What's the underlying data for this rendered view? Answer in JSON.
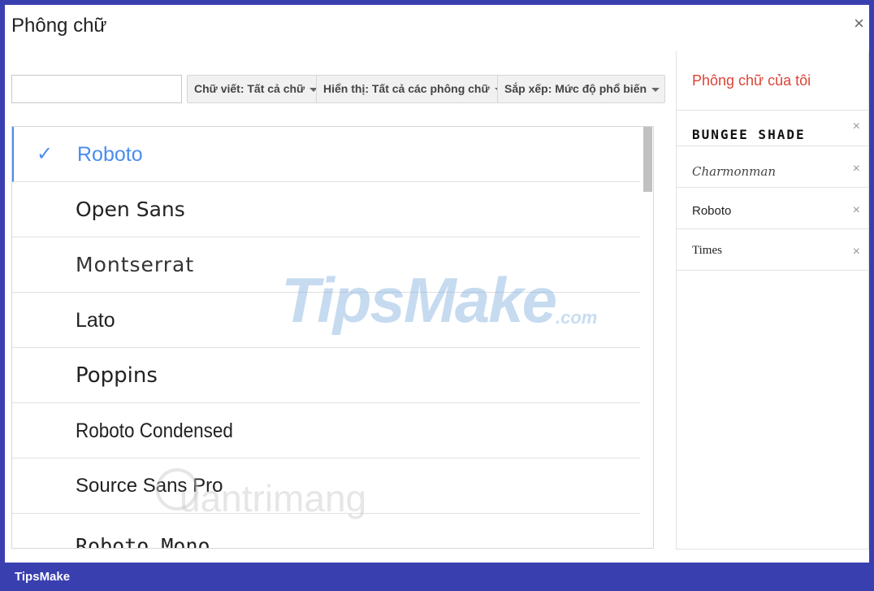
{
  "dialog": {
    "title": "Phông chữ",
    "close_glyph": "×"
  },
  "toolbar": {
    "search_value": "",
    "script_filter": "Chữ viết: Tất cả chữ",
    "show_filter": "Hiển thị: Tất cả các phông chữ",
    "sort_filter": "Sắp xếp: Mức độ phổ biến"
  },
  "fonts": [
    {
      "name": "Roboto",
      "selected": true
    },
    {
      "name": "Open Sans",
      "selected": false
    },
    {
      "name": "Montserrat",
      "selected": false
    },
    {
      "name": "Lato",
      "selected": false
    },
    {
      "name": "Poppins",
      "selected": false
    },
    {
      "name": "Roboto Condensed",
      "selected": false
    },
    {
      "name": "Source Sans Pro",
      "selected": false
    },
    {
      "name": "Roboto Mono",
      "selected": false
    }
  ],
  "check_glyph": "✓",
  "my_fonts": {
    "title": "Phông chữ của tôi",
    "items": [
      "BUNGEE SHADE",
      "Charmonman",
      "Roboto",
      "Times"
    ],
    "remove_glyph": "×"
  },
  "watermarks": {
    "main": "TipsMake",
    "main_suffix": ".com",
    "secondary": "uantrimang"
  },
  "footer": {
    "brand": "TipsMake"
  },
  "colors": {
    "accent_blue": "#4a8df0",
    "my_fonts_red": "#db4437",
    "frame_blue": "#3a3fb0"
  },
  "icons": {
    "close": "close-icon",
    "check": "check-icon",
    "dropdown": "chevron-down-icon",
    "remove": "remove-icon"
  }
}
